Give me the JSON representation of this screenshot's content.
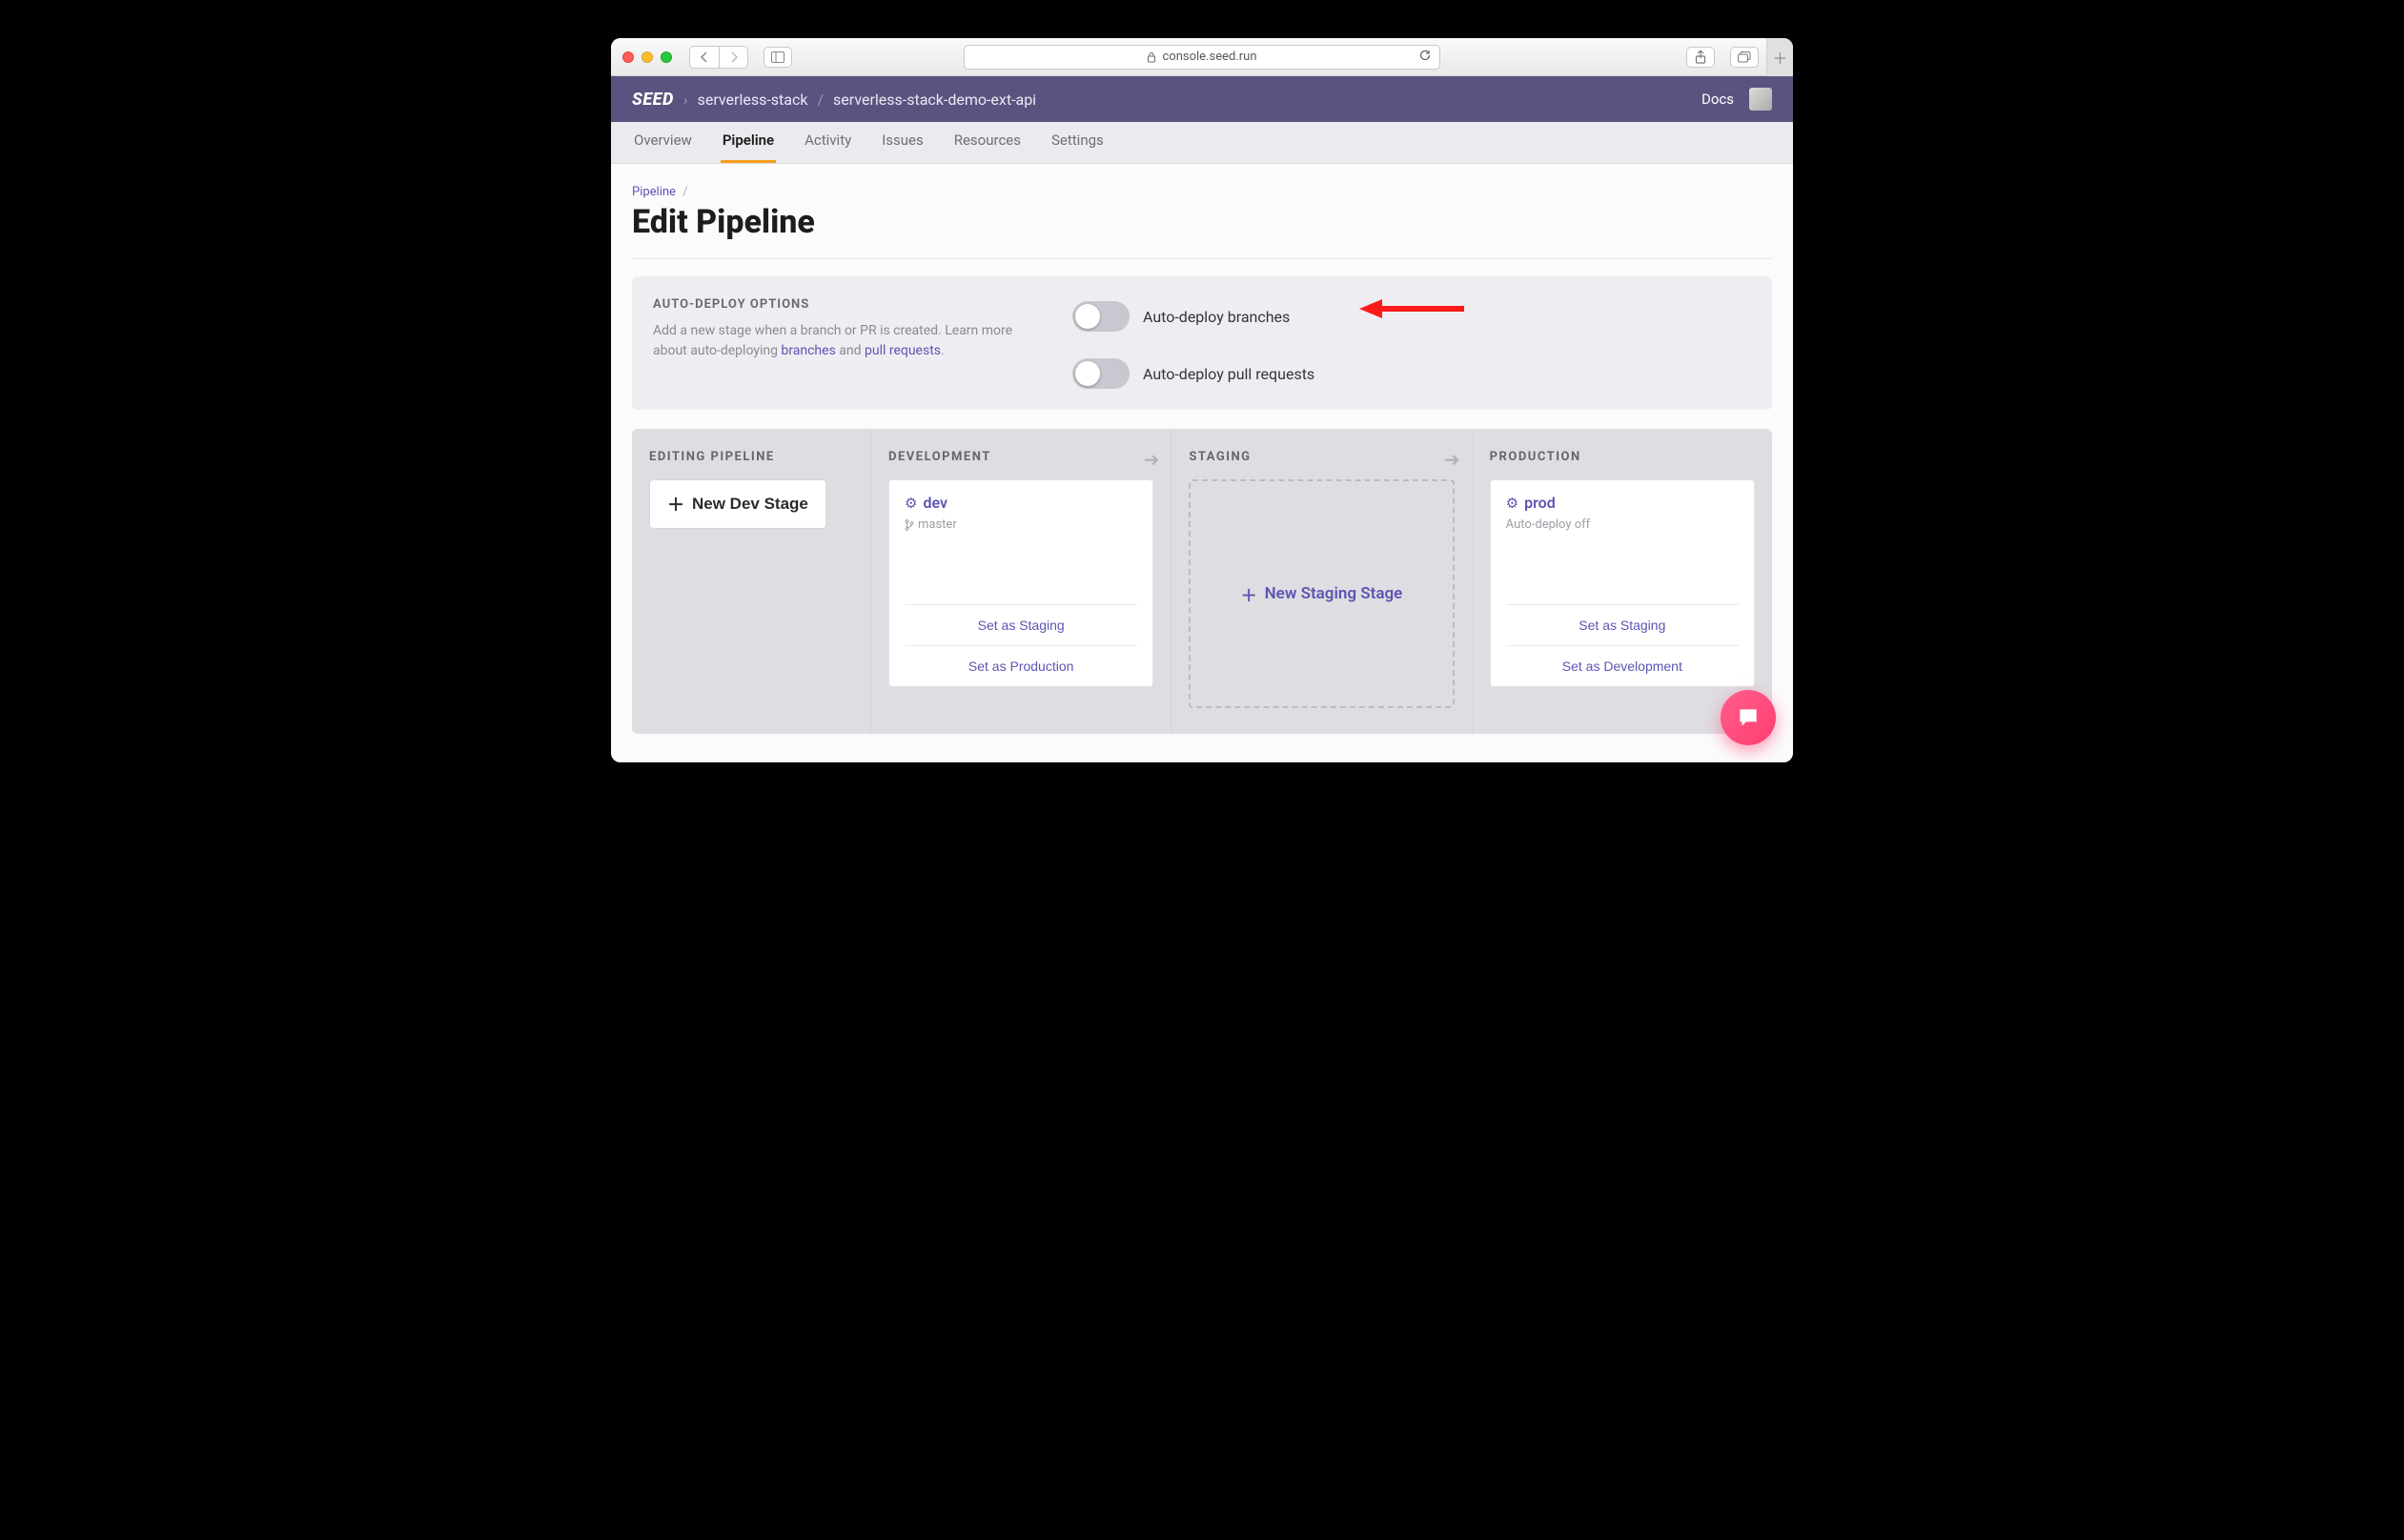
{
  "browser": {
    "url": "console.seed.run"
  },
  "header": {
    "logo": "SEED",
    "breadcrumb_org": "serverless-stack",
    "breadcrumb_project": "serverless-stack-demo-ext-api",
    "docs": "Docs"
  },
  "tabs": [
    "Overview",
    "Pipeline",
    "Activity",
    "Issues",
    "Resources",
    "Settings"
  ],
  "tabs_active_index": 1,
  "page": {
    "crumb": "Pipeline",
    "title": "Edit Pipeline"
  },
  "options": {
    "heading": "AUTO-DEPLOY OPTIONS",
    "desc_prefix": "Add a new stage when a branch or PR is created. Learn more about auto-deploying ",
    "link_branches": "branches",
    "and": " and ",
    "link_prs": "pull requests",
    "period": ".",
    "toggle1_label": "Auto-deploy branches",
    "toggle1_on": false,
    "toggle2_label": "Auto-deploy pull requests",
    "toggle2_on": false
  },
  "pipeline": {
    "editing_heading": "EDITING PIPELINE",
    "new_dev_stage": "New Dev Stage",
    "dev_heading": "DEVELOPMENT",
    "staging_heading": "STAGING",
    "prod_heading": "PRODUCTION",
    "new_staging_stage": "New Staging Stage",
    "dev_stage": {
      "name": "dev",
      "branch": "master",
      "action1": "Set as Staging",
      "action2": "Set as Production"
    },
    "prod_stage": {
      "name": "prod",
      "sub": "Auto-deploy off",
      "action1": "Set as Staging",
      "action2": "Set as Development"
    }
  }
}
